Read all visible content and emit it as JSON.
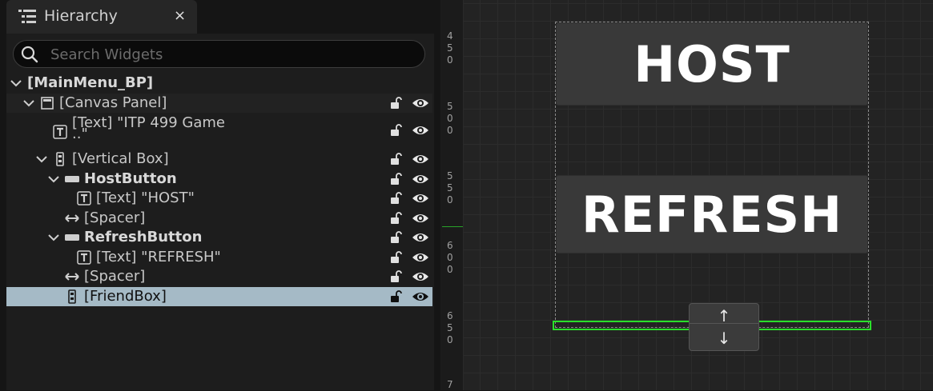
{
  "tab": {
    "title": "Hierarchy",
    "close_glyph": "×",
    "icon": "hierarchy-list-icon"
  },
  "search": {
    "placeholder": "Search Widgets",
    "value": ""
  },
  "tree": [
    {
      "label": "[MainMenu_BP]",
      "bold": true,
      "expander": "expanded"
    },
    {
      "label": "[Canvas Panel]",
      "icon": "canvas-panel-icon",
      "expander": "expanded"
    },
    {
      "label": "[Text] \"ITP 499 Game",
      "label_line2": "..\"",
      "icon": "text-widget-icon"
    },
    {
      "label": "[Vertical Box]",
      "icon": "vertical-box-icon",
      "expander": "expanded"
    },
    {
      "label": "HostButton",
      "bold": true,
      "icon": "button-widget-icon",
      "expander": "expanded"
    },
    {
      "label": "[Text] \"HOST\"",
      "icon": "text-widget-icon"
    },
    {
      "label": "[Spacer]",
      "icon": "spacer-icon"
    },
    {
      "label": "RefreshButton",
      "bold": true,
      "icon": "button-widget-icon",
      "expander": "expanded"
    },
    {
      "label": "[Text] \"REFRESH\"",
      "icon": "text-widget-icon"
    },
    {
      "label": "[Spacer]",
      "icon": "spacer-icon"
    },
    {
      "label": "[FriendBox]",
      "icon": "vertical-box-icon",
      "selected": true
    }
  ],
  "designer": {
    "ruler_labels": [
      "450",
      "500",
      "550",
      "600",
      "650",
      "7"
    ],
    "host_button_text": "HOST",
    "refresh_button_text": "REFRESH",
    "move_up_glyph": "↑",
    "move_down_glyph": "↓",
    "selection_color": "#2adf2a"
  },
  "colors": {
    "selected_row": "#a5bac6",
    "panel_bg": "#1d1d1d",
    "button_bg": "#393939"
  }
}
